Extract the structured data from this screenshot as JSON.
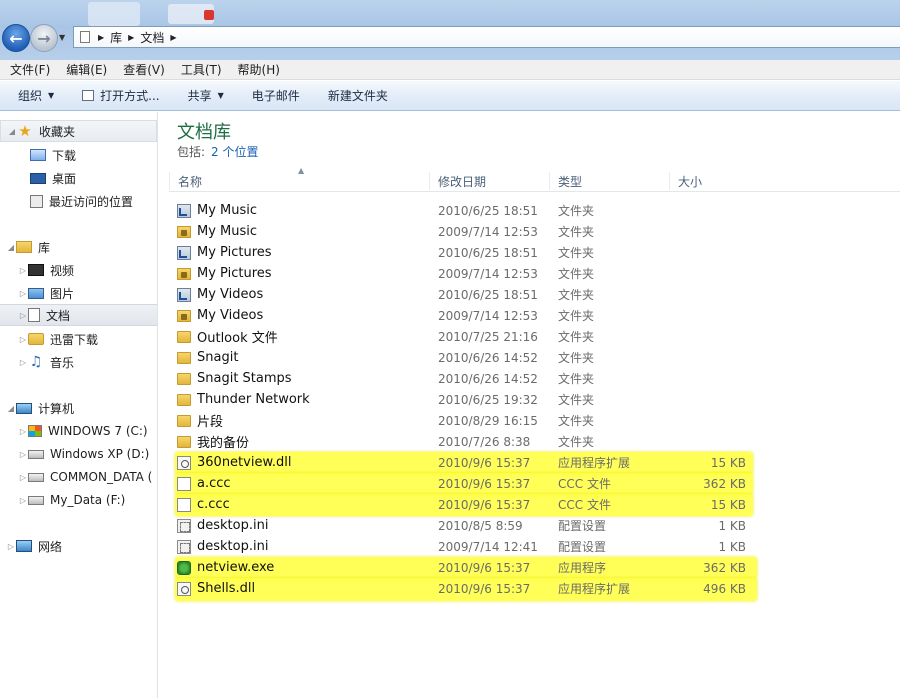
{
  "address": {
    "crumbs": [
      "库",
      "文档"
    ]
  },
  "menu": [
    "文件(F)",
    "编辑(E)",
    "查看(V)",
    "工具(T)",
    "帮助(H)"
  ],
  "toolbar": {
    "organize": "组织",
    "open_with": "打开方式...",
    "share": "共享",
    "email": "电子邮件",
    "new_folder": "新建文件夹"
  },
  "sidebar": {
    "favorites": {
      "label": "收藏夹",
      "items": [
        "下载",
        "桌面",
        "最近访问的位置"
      ]
    },
    "libraries": {
      "label": "库",
      "items": [
        "视频",
        "图片",
        "文档",
        "迅雷下载",
        "音乐"
      ]
    },
    "computer": {
      "label": "计算机",
      "items": [
        "WINDOWS 7 (C:)",
        "Windows XP (D:)",
        "COMMON_DATA (",
        "My_Data (F:)"
      ]
    },
    "network": {
      "label": "网络"
    }
  },
  "library": {
    "title": "文档库",
    "includes_label": "包括:",
    "includes_link": "2 个位置"
  },
  "columns": {
    "name": "名称",
    "date": "修改日期",
    "type": "类型",
    "size": "大小"
  },
  "files": [
    {
      "name": "My Music",
      "date": "2010/6/25 18:51",
      "type": "文件夹",
      "size": "",
      "icon": "folder-link-icon"
    },
    {
      "name": "My Music",
      "date": "2009/7/14 12:53",
      "type": "文件夹",
      "size": "",
      "icon": "folder-lock-icon"
    },
    {
      "name": "My Pictures",
      "date": "2010/6/25 18:51",
      "type": "文件夹",
      "size": "",
      "icon": "folder-link-icon"
    },
    {
      "name": "My Pictures",
      "date": "2009/7/14 12:53",
      "type": "文件夹",
      "size": "",
      "icon": "folder-lock-icon"
    },
    {
      "name": "My Videos",
      "date": "2010/6/25 18:51",
      "type": "文件夹",
      "size": "",
      "icon": "folder-link-icon"
    },
    {
      "name": "My Videos",
      "date": "2009/7/14 12:53",
      "type": "文件夹",
      "size": "",
      "icon": "folder-lock-icon"
    },
    {
      "name": "Outlook 文件",
      "date": "2010/7/25 21:16",
      "type": "文件夹",
      "size": "",
      "icon": "folder-icon"
    },
    {
      "name": "Snagit",
      "date": "2010/6/26 14:52",
      "type": "文件夹",
      "size": "",
      "icon": "folder-icon"
    },
    {
      "name": "Snagit Stamps",
      "date": "2010/6/26 14:52",
      "type": "文件夹",
      "size": "",
      "icon": "folder-icon"
    },
    {
      "name": "Thunder Network",
      "date": "2010/6/25 19:32",
      "type": "文件夹",
      "size": "",
      "icon": "folder-icon"
    },
    {
      "name": "片段",
      "date": "2010/8/29 16:15",
      "type": "文件夹",
      "size": "",
      "icon": "folder-icon"
    },
    {
      "name": "我的备份",
      "date": "2010/7/26 8:38",
      "type": "文件夹",
      "size": "",
      "icon": "folder-icon"
    },
    {
      "name": "360netview.dll",
      "date": "2010/9/6 15:37",
      "type": "应用程序扩展",
      "size": "15 KB",
      "icon": "dll-icon"
    },
    {
      "name": "a.ccc",
      "date": "2010/9/6 15:37",
      "type": "CCC 文件",
      "size": "362 KB",
      "icon": "blank-file-icon"
    },
    {
      "name": "c.ccc",
      "date": "2010/9/6 15:37",
      "type": "CCC 文件",
      "size": "15 KB",
      "icon": "blank-file-icon"
    },
    {
      "name": "desktop.ini",
      "date": "2010/8/5 8:59",
      "type": "配置设置",
      "size": "1 KB",
      "icon": "ini-file-icon"
    },
    {
      "name": "desktop.ini",
      "date": "2009/7/14 12:41",
      "type": "配置设置",
      "size": "1 KB",
      "icon": "ini-file-icon"
    },
    {
      "name": "netview.exe",
      "date": "2010/9/6 15:37",
      "type": "应用程序",
      "size": "362 KB",
      "icon": "exe-icon"
    },
    {
      "name": "Shells.dll",
      "date": "2010/9/6 15:37",
      "type": "应用程序扩展",
      "size": "496 KB",
      "icon": "dll-icon"
    }
  ],
  "highlight_color": "#ffff3c"
}
